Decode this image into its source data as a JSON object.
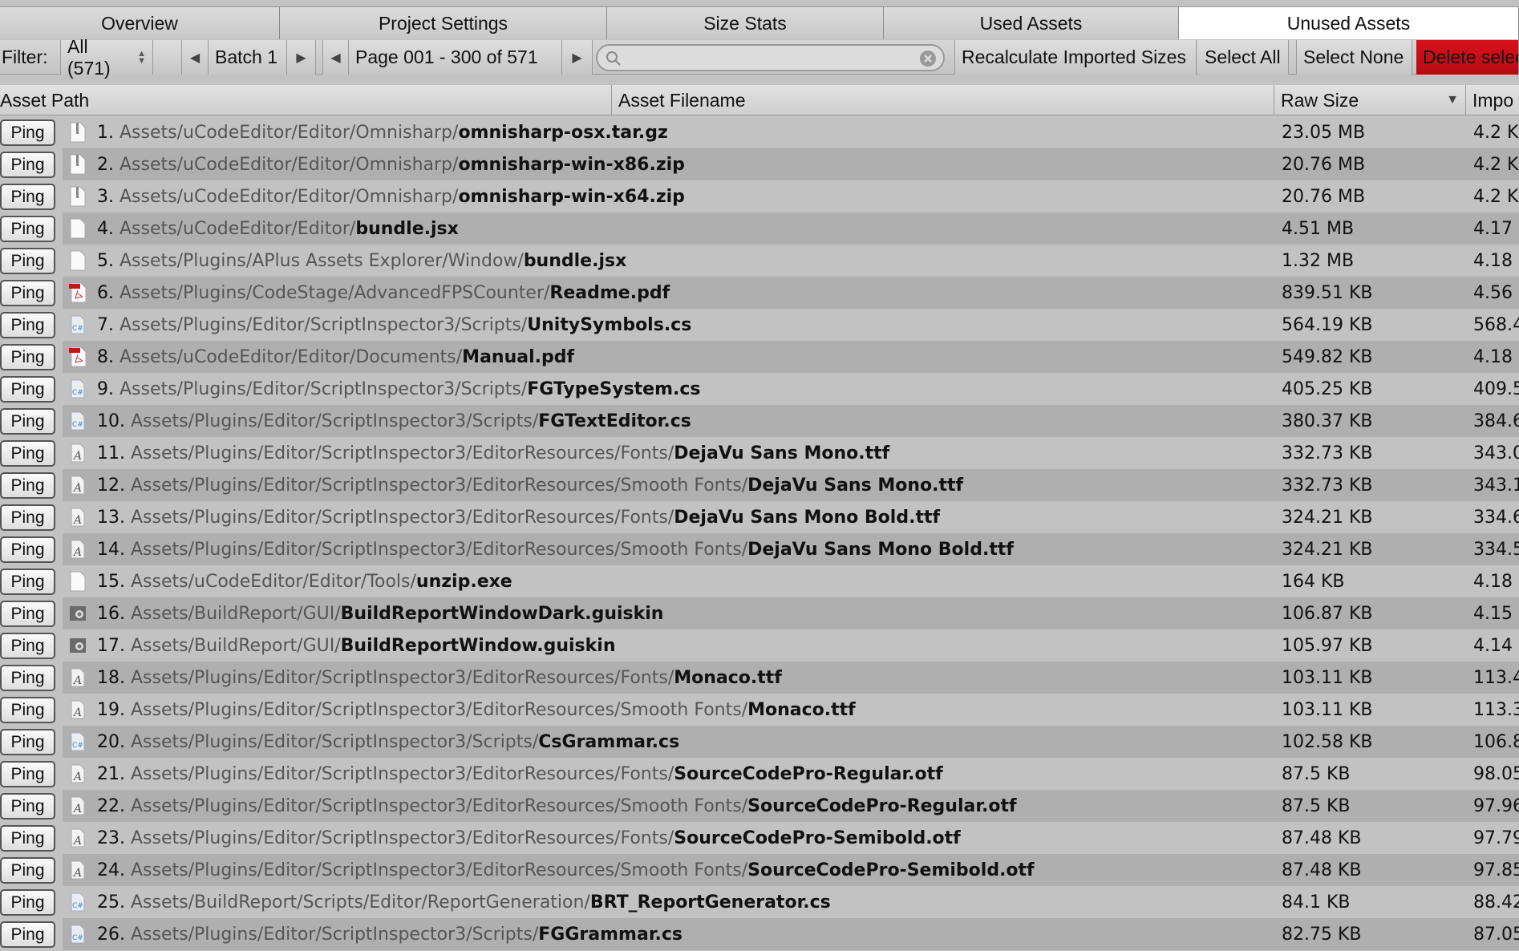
{
  "tabs": [
    {
      "label": "Overview"
    },
    {
      "label": "Project Settings"
    },
    {
      "label": "Size Stats"
    },
    {
      "label": "Used Assets"
    },
    {
      "label": "Unused Assets",
      "active": true
    }
  ],
  "toolbar": {
    "filter_label": "Filter:",
    "filter_value": "All (571)",
    "batch_label": "Batch 1",
    "page_label": "Page 001 - 300 of 571",
    "search_placeholder": "",
    "recalculate": "Recalculate Imported Sizes",
    "select_all": "Select All",
    "select_none": "Select None",
    "delete_selected": "Delete selec",
    "delete_color": "#c80d16"
  },
  "columns": {
    "path": "Asset Path",
    "filename": "Asset Filename",
    "raw": "Raw Size",
    "imported": "Impo",
    "sort": "descending"
  },
  "ping_label": "Ping",
  "rows": [
    {
      "num": "1.",
      "path": "Assets/uCodeEditor/Editor/Omnisharp/",
      "file": "omnisharp-osx.tar.gz",
      "raw": "23.05 MB",
      "imp": "4.2 K",
      "icon": "archive"
    },
    {
      "num": "2.",
      "path": "Assets/uCodeEditor/Editor/Omnisharp/",
      "file": "omnisharp-win-x86.zip",
      "raw": "20.76 MB",
      "imp": "4.2 K",
      "icon": "archive"
    },
    {
      "num": "3.",
      "path": "Assets/uCodeEditor/Editor/Omnisharp/",
      "file": "omnisharp-win-x64.zip",
      "raw": "20.76 MB",
      "imp": "4.2 K",
      "icon": "archive"
    },
    {
      "num": "4.",
      "path": "Assets/uCodeEditor/Editor/",
      "file": "bundle.jsx",
      "raw": "4.51 MB",
      "imp": "4.17",
      "icon": "file"
    },
    {
      "num": "5.",
      "path": "Assets/Plugins/APlus Assets Explorer/Window/",
      "file": "bundle.jsx",
      "raw": "1.32 MB",
      "imp": "4.18",
      "icon": "file"
    },
    {
      "num": "6.",
      "path": "Assets/Plugins/CodeStage/AdvancedFPSCounter/",
      "file": "Readme.pdf",
      "raw": "839.51 KB",
      "imp": "4.56",
      "icon": "pdf"
    },
    {
      "num": "7.",
      "path": "Assets/Plugins/Editor/ScriptInspector3/Scripts/",
      "file": "UnitySymbols.cs",
      "raw": "564.19 KB",
      "imp": "568.4",
      "icon": "csharp"
    },
    {
      "num": "8.",
      "path": "Assets/uCodeEditor/Editor/Documents/",
      "file": "Manual.pdf",
      "raw": "549.82 KB",
      "imp": "4.18",
      "icon": "pdf"
    },
    {
      "num": "9.",
      "path": "Assets/Plugins/Editor/ScriptInspector3/Scripts/",
      "file": "FGTypeSystem.cs",
      "raw": "405.25 KB",
      "imp": "409.5",
      "icon": "csharp"
    },
    {
      "num": "10.",
      "path": "Assets/Plugins/Editor/ScriptInspector3/Scripts/",
      "file": "FGTextEditor.cs",
      "raw": "380.37 KB",
      "imp": "384.6",
      "icon": "csharp"
    },
    {
      "num": "11.",
      "path": "Assets/Plugins/Editor/ScriptInspector3/EditorResources/Fonts/",
      "file": "DejaVu Sans Mono.ttf",
      "raw": "332.73 KB",
      "imp": "343.0",
      "icon": "font"
    },
    {
      "num": "12.",
      "path": "Assets/Plugins/Editor/ScriptInspector3/EditorResources/Smooth Fonts/",
      "file": "DejaVu Sans Mono.ttf",
      "raw": "332.73 KB",
      "imp": "343.1",
      "icon": "font"
    },
    {
      "num": "13.",
      "path": "Assets/Plugins/Editor/ScriptInspector3/EditorResources/Fonts/",
      "file": "DejaVu Sans Mono Bold.ttf",
      "raw": "324.21 KB",
      "imp": "334.6",
      "icon": "font"
    },
    {
      "num": "14.",
      "path": "Assets/Plugins/Editor/ScriptInspector3/EditorResources/Smooth Fonts/",
      "file": "DejaVu Sans Mono Bold.ttf",
      "raw": "324.21 KB",
      "imp": "334.5",
      "icon": "font"
    },
    {
      "num": "15.",
      "path": "Assets/uCodeEditor/Editor/Tools/",
      "file": "unzip.exe",
      "raw": "164 KB",
      "imp": "4.18",
      "icon": "file"
    },
    {
      "num": "16.",
      "path": "Assets/BuildReport/GUI/",
      "file": "BuildReportWindowDark.guiskin",
      "raw": "106.87 KB",
      "imp": "4.15",
      "icon": "guiskin"
    },
    {
      "num": "17.",
      "path": "Assets/BuildReport/GUI/",
      "file": "BuildReportWindow.guiskin",
      "raw": "105.97 KB",
      "imp": "4.14",
      "icon": "guiskin"
    },
    {
      "num": "18.",
      "path": "Assets/Plugins/Editor/ScriptInspector3/EditorResources/Fonts/",
      "file": "Monaco.ttf",
      "raw": "103.11 KB",
      "imp": "113.4",
      "icon": "font"
    },
    {
      "num": "19.",
      "path": "Assets/Plugins/Editor/ScriptInspector3/EditorResources/Smooth Fonts/",
      "file": "Monaco.ttf",
      "raw": "103.11 KB",
      "imp": "113.3",
      "icon": "font"
    },
    {
      "num": "20.",
      "path": "Assets/Plugins/Editor/ScriptInspector3/Scripts/",
      "file": "CsGrammar.cs",
      "raw": "102.58 KB",
      "imp": "106.8",
      "icon": "csharp"
    },
    {
      "num": "21.",
      "path": "Assets/Plugins/Editor/ScriptInspector3/EditorResources/Fonts/",
      "file": "SourceCodePro-Regular.otf",
      "raw": "87.5 KB",
      "imp": "98.05",
      "icon": "font"
    },
    {
      "num": "22.",
      "path": "Assets/Plugins/Editor/ScriptInspector3/EditorResources/Smooth Fonts/",
      "file": "SourceCodePro-Regular.otf",
      "raw": "87.5 KB",
      "imp": "97.96",
      "icon": "font"
    },
    {
      "num": "23.",
      "path": "Assets/Plugins/Editor/ScriptInspector3/EditorResources/Fonts/",
      "file": "SourceCodePro-Semibold.otf",
      "raw": "87.48 KB",
      "imp": "97.79",
      "icon": "font"
    },
    {
      "num": "24.",
      "path": "Assets/Plugins/Editor/ScriptInspector3/EditorResources/Smooth Fonts/",
      "file": "SourceCodePro-Semibold.otf",
      "raw": "87.48 KB",
      "imp": "97.85",
      "icon": "font"
    },
    {
      "num": "25.",
      "path": "Assets/BuildReport/Scripts/Editor/ReportGeneration/",
      "file": "BRT_ReportGenerator.cs",
      "raw": "84.1 KB",
      "imp": "88.42",
      "icon": "csharp"
    },
    {
      "num": "26.",
      "path": "Assets/Plugins/Editor/ScriptInspector3/Scripts/",
      "file": "FGGrammar.cs",
      "raw": "82.75 KB",
      "imp": "87.05",
      "icon": "csharp"
    }
  ]
}
